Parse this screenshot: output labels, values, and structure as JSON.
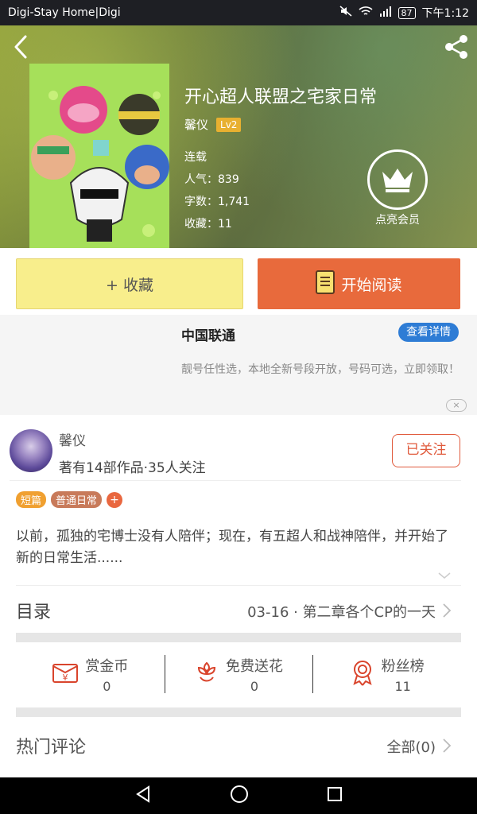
{
  "status_bar": {
    "carrier": "Digi-Stay Home|Digi",
    "battery": "87",
    "time": "下午1:12"
  },
  "book": {
    "title": "开心超人联盟之宅家日常",
    "author": "馨仪",
    "level": "Lv2",
    "status": "连载",
    "popularity": "人气：839",
    "word_count": "字数：1,741",
    "favorites": "收藏：11"
  },
  "vip": {
    "label": "点亮会员"
  },
  "actions": {
    "favorite": "+ 收藏",
    "read": "开始阅读"
  },
  "ad": {
    "title": "中国联通",
    "button": "查看详情",
    "text": "靓号任性选，本地全新号段开放，号码可选，立即领取！",
    "close": "×"
  },
  "author_section": {
    "name": "馨仪",
    "stats": "著有14部作品·35人关注",
    "follow_button": "已关注",
    "tags": [
      "短篇",
      "普通日常"
    ],
    "add_tag": "+",
    "description": "以前，孤独的宅博士没有人陪伴；现在，有五超人和战神陪伴，并开始了新的日常生活......"
  },
  "toc": {
    "label": "目录",
    "latest": "03-16 · 第二章各个CP的一天"
  },
  "stats": [
    {
      "label": "赏金币",
      "value": "0",
      "icon": "red-envelope-icon"
    },
    {
      "label": "免费送花",
      "value": "0",
      "icon": "flower-icon"
    },
    {
      "label": "粉丝榜",
      "value": "11",
      "icon": "medal-icon"
    }
  ],
  "comments": {
    "label": "热门评论",
    "all": "全部(0)"
  },
  "colors": {
    "accent_orange": "#e86a3c",
    "fav_yellow": "#f8ee8c",
    "link_blue": "#2e7cd5",
    "icon_red": "#d9442c"
  }
}
